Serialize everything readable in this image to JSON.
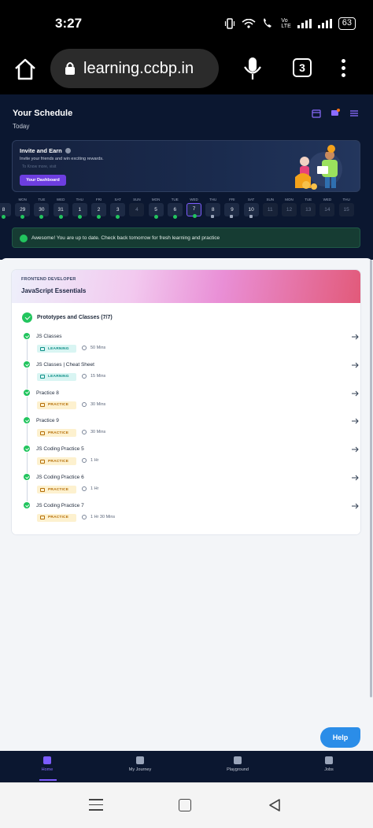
{
  "status_bar": {
    "time": "3:27",
    "battery": "63"
  },
  "browser": {
    "url": "learning.ccbp.in",
    "tab_count": "3"
  },
  "schedule": {
    "title": "Your Schedule",
    "subtitle": "Today"
  },
  "invite": {
    "title": "Invite and Earn",
    "description": "Invite your friends and win exciting rewards.",
    "faint_text": "To Know more, visit",
    "button": "Your Dashboard"
  },
  "days": [
    {
      "label": "",
      "date": "8",
      "state": "partial"
    },
    {
      "label": "MON",
      "date": "29",
      "state": "done"
    },
    {
      "label": "TUE",
      "date": "30",
      "state": "done"
    },
    {
      "label": "WED",
      "date": "31",
      "state": "done"
    },
    {
      "label": "THU",
      "date": "1",
      "state": "done"
    },
    {
      "label": "FRI",
      "date": "2",
      "state": "done"
    },
    {
      "label": "SAT",
      "date": "3",
      "state": "done"
    },
    {
      "label": "SUN",
      "date": "4",
      "state": "none"
    },
    {
      "label": "MON",
      "date": "5",
      "state": "done"
    },
    {
      "label": "TUE",
      "date": "6",
      "state": "done"
    },
    {
      "label": "WED",
      "date": "7",
      "state": "today"
    },
    {
      "label": "THU",
      "date": "8",
      "state": "locked"
    },
    {
      "label": "FRI",
      "date": "9",
      "state": "locked"
    },
    {
      "label": "SAT",
      "date": "10",
      "state": "locked"
    },
    {
      "label": "SUN",
      "date": "11",
      "state": "future"
    },
    {
      "label": "MON",
      "date": "12",
      "state": "future"
    },
    {
      "label": "TUE",
      "date": "13",
      "state": "future"
    },
    {
      "label": "WED",
      "date": "14",
      "state": "future"
    },
    {
      "label": "THU",
      "date": "15",
      "state": "future"
    }
  ],
  "uptodate": {
    "message": "Awesome! You are up to date. Check back tomorrow for fresh learning and practice"
  },
  "course": {
    "kicker": "FRONTEND DEVELOPER",
    "title": "JavaScript Essentials",
    "topic_title": "Prototypes and Classes (7/7)",
    "items": [
      {
        "title": "JS Classes",
        "type": "LEARNING",
        "duration": "50 Mins"
      },
      {
        "title": "JS Classes | Cheat Sheet",
        "type": "LEARNING",
        "duration": "15 Mins"
      },
      {
        "title": "Practice 8",
        "type": "PRACTICE",
        "duration": "30 Mins"
      },
      {
        "title": "Practice 9",
        "type": "PRACTICE",
        "duration": "30 Mins"
      },
      {
        "title": "JS Coding Practice 5",
        "type": "PRACTICE",
        "duration": "1 Hr"
      },
      {
        "title": "JS Coding Practice 6",
        "type": "PRACTICE",
        "duration": "1 Hr"
      },
      {
        "title": "JS Coding Practice 7",
        "type": "PRACTICE",
        "duration": "1 Hr 30 Mins"
      }
    ]
  },
  "help": {
    "label": "Help"
  },
  "bottom_nav": [
    {
      "label": "Home",
      "active": true
    },
    {
      "label": "My Journey",
      "active": false
    },
    {
      "label": "Playground",
      "active": false
    },
    {
      "label": "Jobs",
      "active": false
    }
  ],
  "colors": {
    "accent": "#7c5cff",
    "success": "#22c55e",
    "dark_bg": "#0b1730",
    "help": "#2b8de8"
  }
}
